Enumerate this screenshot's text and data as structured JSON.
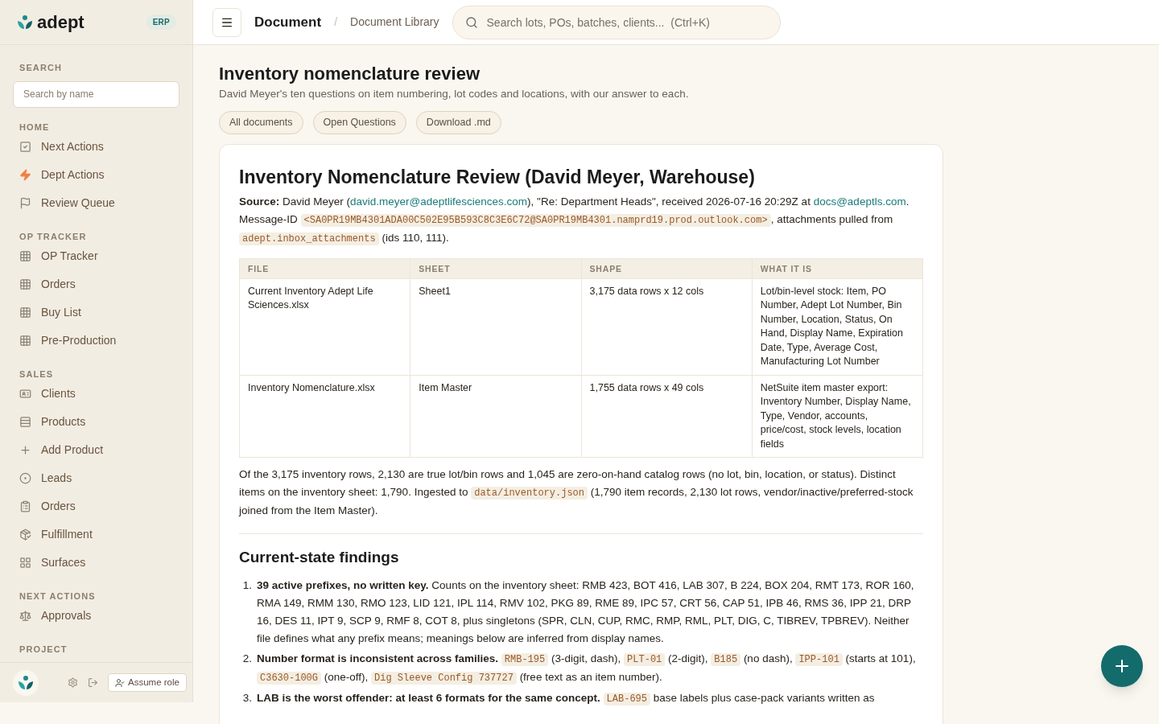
{
  "brand": {
    "logo": "adept",
    "badge": "ERP"
  },
  "sidebar": {
    "search": {
      "label": "SEARCH",
      "placeholder": "Search by name"
    },
    "sections": [
      {
        "title": "HOME",
        "items": [
          {
            "label": "Next Actions"
          },
          {
            "label": "Dept Actions"
          },
          {
            "label": "Review Queue"
          }
        ]
      },
      {
        "title": "OP TRACKER",
        "items": [
          {
            "label": "OP Tracker"
          },
          {
            "label": "Orders"
          },
          {
            "label": "Buy List"
          },
          {
            "label": "Pre-Production"
          }
        ]
      },
      {
        "title": "SALES",
        "items": [
          {
            "label": "Clients"
          },
          {
            "label": "Products"
          },
          {
            "label": "Add Product"
          },
          {
            "label": "Leads"
          },
          {
            "label": "Orders"
          },
          {
            "label": "Fulfillment"
          },
          {
            "label": "Surfaces"
          }
        ]
      },
      {
        "title": "NEXT ACTIONS",
        "items": [
          {
            "label": "Approvals"
          }
        ]
      },
      {
        "title": "PROJECT"
      }
    ],
    "footer": {
      "assume_role": "Assume role"
    }
  },
  "header": {
    "breadcrumb": [
      "Document",
      "Document Library"
    ],
    "separator": "/",
    "search": {
      "placeholder": "Search lots, POs, batches, clients...  (Ctrl+K)"
    }
  },
  "page": {
    "title": "Inventory nomenclature review",
    "subtitle": "David Meyer's ten questions on item numbering, lot codes and locations, with our answer to each.",
    "actions": [
      "All documents",
      "Open Questions",
      "Download .md"
    ]
  },
  "document": {
    "title": "Inventory Nomenclature Review (David Meyer, Warehouse)",
    "source": [
      {
        "kind": "bold",
        "text": "Source:"
      },
      {
        "kind": "text",
        "text": " David Meyer ("
      },
      {
        "kind": "link",
        "text": "david.meyer@adeptlifesciences.com"
      },
      {
        "kind": "text",
        "text": "), \"Re: Department Heads\", received 2026-07-16 20:29Z at "
      },
      {
        "kind": "link",
        "text": "docs@adeptls.com"
      },
      {
        "kind": "text",
        "text": ". Message-ID "
      },
      {
        "kind": "code",
        "text": "<SA0PR19MB4301ADA00C502E95B593C8C3E6C72@SA0PR19MB4301.namprd19.prod.outlook.com>"
      },
      {
        "kind": "text",
        "text": ", attachments pulled from "
      },
      {
        "kind": "code",
        "text": "adept.inbox_attachments"
      },
      {
        "kind": "text",
        "text": " (ids 110, 111)."
      }
    ],
    "table": {
      "columns": [
        "FILE",
        "SHEET",
        "SHAPE",
        "WHAT IT IS"
      ],
      "rows": [
        [
          "Current Inventory Adept Life Sciences.xlsx",
          "Sheet1",
          "3,175 data rows x 12 cols",
          "Lot/bin-level stock: Item, PO Number, Adept Lot Number, Bin Number, Location, Status, On Hand, Display Name, Expiration Date, Type, Average Cost, Manufacturing Lot Number"
        ],
        [
          "Inventory Nomenclature.xlsx",
          "Item Master",
          "1,755 data rows x 49 cols",
          "NetSuite item master export: Inventory Number, Display Name, Type, Vendor, accounts, price/cost, stock levels, location fields"
        ]
      ]
    },
    "summary": [
      {
        "kind": "text",
        "text": "Of the 3,175 inventory rows, 2,130 are true lot/bin rows and 1,045 are zero-on-hand catalog rows (no lot, bin, location, or status). Distinct items on the inventory sheet: 1,790. Ingested to "
      },
      {
        "kind": "code",
        "text": "data/inventory.json"
      },
      {
        "kind": "text",
        "text": " (1,790 item records, 2,130 lot rows, vendor/inactive/preferred-stock joined from the Item Master)."
      }
    ],
    "section_title": "Current-state findings",
    "findings": [
      {
        "number": "1.",
        "segments": [
          {
            "kind": "bold",
            "text": "39 active prefixes, no written key."
          },
          {
            "kind": "text",
            "text": " Counts on the inventory sheet: RMB 423, BOT 416, LAB 307, B 224, BOX 204, RMT 173, ROR 160, RMA 149, RMM 130, RMO 123, LID 121, IPL 114, RMV 102, PKG 89, RME 89, IPC 57, CRT 56, CAP 51, IPB 46, RMS 36, IPP 21, DRP 16, DES 11, IPT 9, SCP 9, RMF 8, COT 8, plus singletons (SPR, CLN, CUP, RMC, RMP, RML, PLT, DIG, C, TIBREV, TPBREV). Neither file defines what any prefix means; meanings below are inferred from display names."
          }
        ]
      },
      {
        "number": "2.",
        "segments": [
          {
            "kind": "bold",
            "text": "Number format is inconsistent across families."
          },
          {
            "kind": "gap"
          },
          {
            "kind": "code",
            "text": "RMB-195"
          },
          {
            "kind": "text",
            "text": " (3-digit, dash), "
          },
          {
            "kind": "code",
            "text": "PLT-01"
          },
          {
            "kind": "text",
            "text": " (2-digit), "
          },
          {
            "kind": "code",
            "text": "B185"
          },
          {
            "kind": "text",
            "text": " (no dash), "
          },
          {
            "kind": "code",
            "text": "IPP-101"
          },
          {
            "kind": "text",
            "text": " (starts at 101), "
          },
          {
            "kind": "code",
            "text": "C3630-100G"
          },
          {
            "kind": "text",
            "text": " (one-off), "
          },
          {
            "kind": "code",
            "text": "Dig Sleeve Config 737727"
          },
          {
            "kind": "text",
            "text": " (free text as an item number)."
          }
        ]
      },
      {
        "number": "3.",
        "segments": [
          {
            "kind": "bold",
            "text": "LAB is the worst offender: at least 6 formats for the same concept."
          },
          {
            "kind": "gap"
          },
          {
            "kind": "code",
            "text": "LAB-695"
          },
          {
            "kind": "text",
            "text": " base labels plus case-pack variants written as"
          }
        ]
      }
    ]
  }
}
